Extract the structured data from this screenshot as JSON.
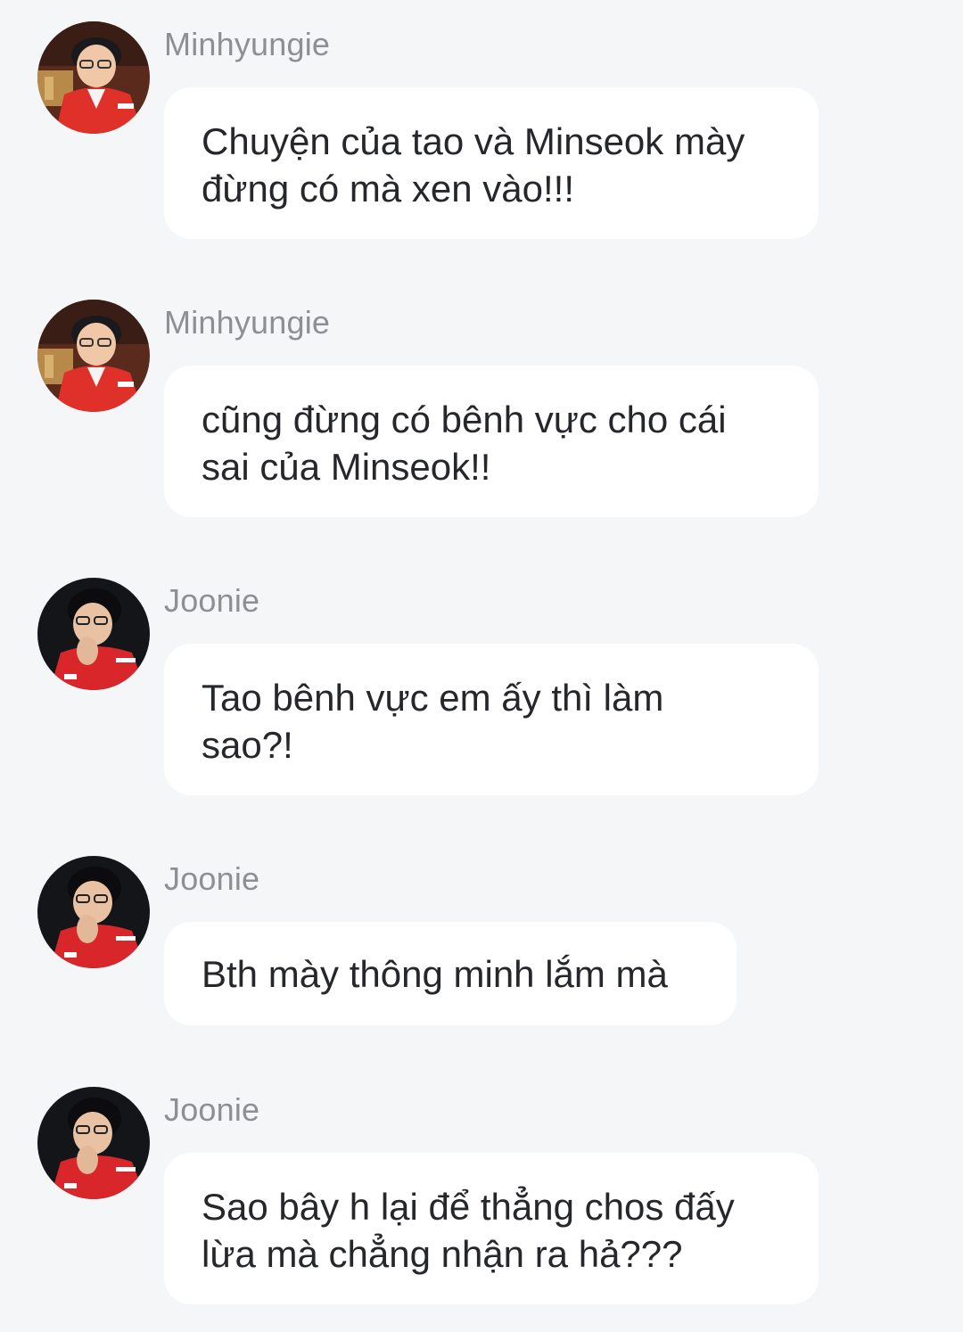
{
  "messages": [
    {
      "sender": "Minhyungie",
      "avatar": "minhyungie-avatar",
      "lines": [
        "Chuyện của tao và Minseok mày",
        "đừng có mà xen vào!!!"
      ]
    },
    {
      "sender": "Minhyungie",
      "avatar": "minhyungie-avatar",
      "lines": [
        "cũng đừng có bênh vực cho cái",
        "sai của Minseok!!"
      ]
    },
    {
      "sender": "Joonie",
      "avatar": "joonie-avatar",
      "lines": [
        "Tao bênh vực em ấy thì làm",
        "sao?!"
      ]
    },
    {
      "sender": "Joonie",
      "avatar": "joonie-avatar",
      "lines": [
        "Bth mày thông minh lắm mà"
      ]
    },
    {
      "sender": "Joonie",
      "avatar": "joonie-avatar",
      "lines": [
        "Sao bây h lại để thẳng chos đấy",
        "lừa mà chẳng nhận ra hả???"
      ]
    }
  ],
  "colors": {
    "background": "#f5f6f8",
    "bubble": "#ffffff",
    "sender_name": "#8e8f93",
    "message_text": "#26272b"
  }
}
